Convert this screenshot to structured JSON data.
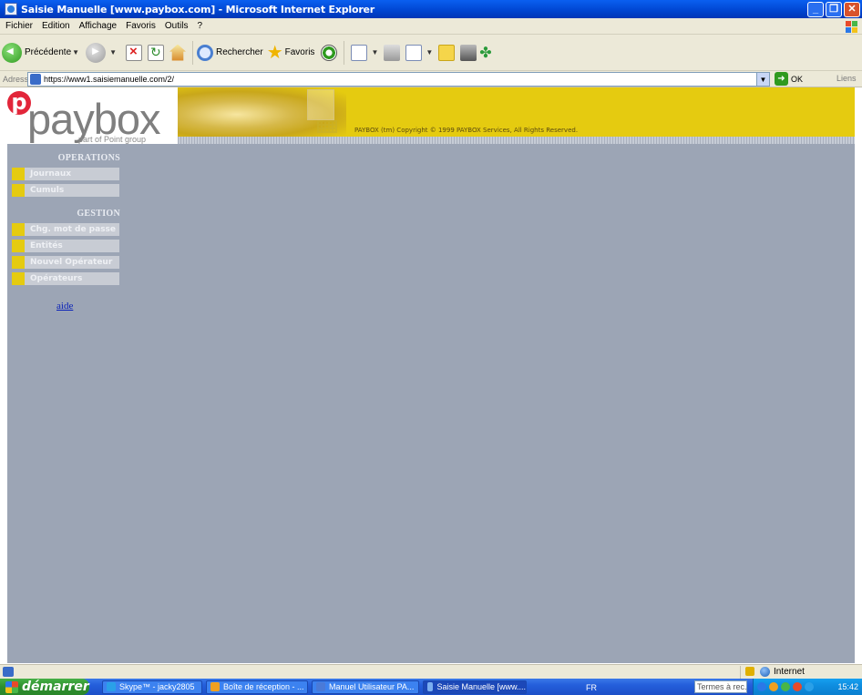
{
  "window": {
    "title": "Saisie Manuelle [www.paybox.com] - Microsoft Internet Explorer",
    "buttons": [
      "_",
      "❐",
      "✕"
    ]
  },
  "menu": [
    "Fichier",
    "Edition",
    "Affichage",
    "Favoris",
    "Outils",
    "?"
  ],
  "toolbar": {
    "back_label": "Précédente",
    "search_label": "Rechercher",
    "favorites_label": "Favoris"
  },
  "address": {
    "label": "Adresse",
    "url": "https://www1.saisiemanuelle.com/2/",
    "go_label": "OK",
    "links_label": "Liens"
  },
  "page": {
    "logo_text": "paybox",
    "logo_sub": "part of Point group",
    "copyright": "PAYBOX (tm) Copyright © 1999 PAYBOX Services, All Rights Reserved.",
    "operations_heading": "OPERATIONS",
    "operations": [
      "Journaux",
      "Cumuls"
    ],
    "gestion_heading": "GESTION",
    "gestion": [
      "Chg. mot de passe",
      "Entités",
      "Nouvel Opérateur",
      "Opérateurs"
    ],
    "help_link": "aide",
    "colors": {
      "banner_yellow": "#e5cb10",
      "page_bg": "#9ca5b5",
      "logo_red": "#e2263a"
    }
  },
  "statusbar": {
    "zone": "Internet"
  },
  "taskbar": {
    "start_label": "démarrer",
    "tasks": [
      "Skype™ - jacky2805",
      "Boîte de réception - ...",
      "Manuel Utilisateur PA...",
      "Saisie Manuelle [www...."
    ],
    "language": "FR",
    "search_placeholder": "Termes à rec...",
    "clock": "15:42"
  }
}
